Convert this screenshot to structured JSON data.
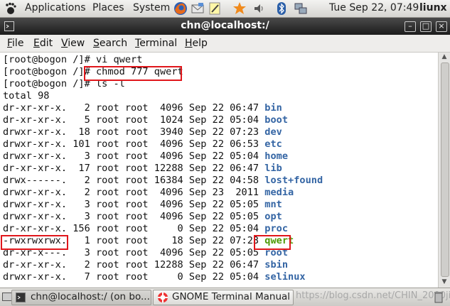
{
  "top_panel": {
    "menus": [
      "Applications",
      "Places",
      "System"
    ],
    "datetime": "Tue Sep 22, 07:49",
    "user": "liunx",
    "icons": [
      "gnome-foot-icon",
      "firefox-icon",
      "mail-icon",
      "notes-icon",
      "update-icon",
      "volume-icon",
      "bluetooth-icon",
      "network-icon"
    ]
  },
  "window": {
    "title": "chn@localhost:/",
    "controls": [
      "minimize-icon",
      "maximize-icon",
      "close-icon"
    ]
  },
  "menubar": {
    "items": [
      {
        "mnemonic": "F",
        "rest": "ile"
      },
      {
        "mnemonic": "E",
        "rest": "dit"
      },
      {
        "mnemonic": "V",
        "rest": "iew"
      },
      {
        "mnemonic": "S",
        "rest": "earch"
      },
      {
        "mnemonic": "T",
        "rest": "erminal"
      },
      {
        "mnemonic": "H",
        "rest": "elp"
      }
    ]
  },
  "terminal": {
    "lines": [
      {
        "text": "[root@bogon /]# vi qwert"
      },
      {
        "text": "[root@bogon /]# chmod 777 qwert"
      },
      {
        "text": "[root@bogon /]# ls -l"
      },
      {
        "text": "total 98"
      },
      {
        "text": "dr-xr-xr-x.   2 root root  4096 Sep 22 06:47 ",
        "name": "bin",
        "color": "blue"
      },
      {
        "text": "dr-xr-xr-x.   5 root root  1024 Sep 22 05:04 ",
        "name": "boot",
        "color": "blue"
      },
      {
        "text": "drwxr-xr-x.  18 root root  3940 Sep 22 07:23 ",
        "name": "dev",
        "color": "blue"
      },
      {
        "text": "drwxr-xr-x. 101 root root  4096 Sep 22 06:53 ",
        "name": "etc",
        "color": "blue"
      },
      {
        "text": "drwxr-xr-x.   3 root root  4096 Sep 22 05:04 ",
        "name": "home",
        "color": "blue"
      },
      {
        "text": "dr-xr-xr-x.  17 root root 12288 Sep 22 06:47 ",
        "name": "lib",
        "color": "blue"
      },
      {
        "text": "drwx------.   2 root root 16384 Sep 22 04:58 ",
        "name": "lost+found",
        "color": "blue"
      },
      {
        "text": "drwxr-xr-x.   2 root root  4096 Sep 23  2011 ",
        "name": "media",
        "color": "blue"
      },
      {
        "text": "drwxr-xr-x.   3 root root  4096 Sep 22 05:05 ",
        "name": "mnt",
        "color": "blue"
      },
      {
        "text": "drwxr-xr-x.   3 root root  4096 Sep 22 05:05 ",
        "name": "opt",
        "color": "blue"
      },
      {
        "text": "dr-xr-xr-x. 156 root root     0 Sep 22 05:04 ",
        "name": "proc",
        "color": "blue"
      },
      {
        "text": "-rwxrwxrwx.   1 root root    18 Sep 22 07:23 ",
        "name": "qwert",
        "color": "green"
      },
      {
        "text": "dr-xr-x---.   3 root root  4096 Sep 22 05:05 ",
        "name": "root",
        "color": "blue"
      },
      {
        "text": "dr-xr-xr-x.   2 root root 12288 Sep 22 06:47 ",
        "name": "sbin",
        "color": "blue"
      },
      {
        "text": "drwxr-xr-x.   7 root root     0 Sep 22 05:04 ",
        "name": "selinux",
        "color": "blue"
      }
    ]
  },
  "taskbar": {
    "tasks": [
      {
        "label": "chn@localhost:/ (on bo..."
      },
      {
        "label": "GNOME Terminal Manual"
      }
    ],
    "watermark": "https://blog.csdn.net/CHIN_2000jim"
  },
  "colors": {
    "dir": "#3465a4",
    "exec": "#4e9a06",
    "annotation": "#e0161b"
  }
}
